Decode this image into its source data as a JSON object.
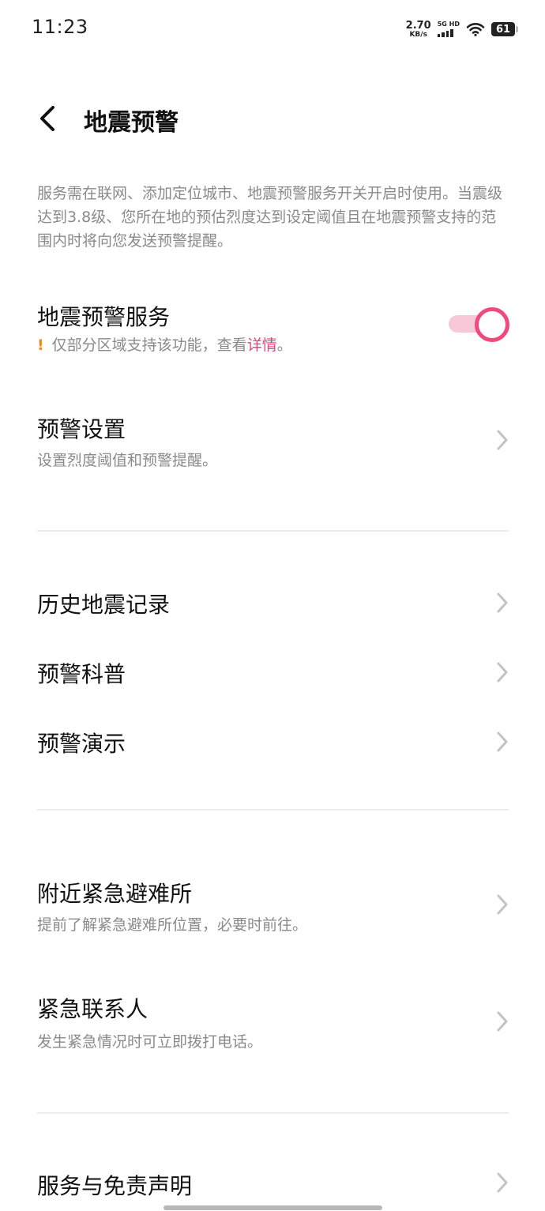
{
  "status_bar": {
    "time": "11:23",
    "net_speed_value": "2.70",
    "net_speed_unit": "KB/s",
    "network_type": "5G HD",
    "battery": "61"
  },
  "header": {
    "title": "地震预警"
  },
  "intro": "服务需在联网、添加定位城市、地震预警服务开关开启时使用。当震级达到3.8级、您所在地的预估烈度达到设定阈值且在地震预警支持的范围内时将向您发送预警提醒。",
  "service": {
    "title": "地震预警服务",
    "warning_mark": "!",
    "note_prefix": "仅部分区域支持该功能，查看",
    "note_link": "详情",
    "note_suffix": "。",
    "enabled": true
  },
  "alert_settings": {
    "title": "预警设置",
    "subtitle": "设置烈度阈值和预警提醒。"
  },
  "history": {
    "title": "历史地震记录"
  },
  "science": {
    "title": "预警科普"
  },
  "demo": {
    "title": "预警演示"
  },
  "shelter": {
    "title": "附近紧急避难所",
    "subtitle": "提前了解紧急避难所位置，必要时前往。"
  },
  "contacts": {
    "title": "紧急联系人",
    "subtitle": "发生紧急情况时可立即拨打电话。"
  },
  "disclaimer": {
    "title": "服务与免责声明"
  },
  "colors": {
    "accent": "#ef4a7c",
    "warning": "#f08a1c",
    "secondary_text": "#8a8a8a"
  }
}
